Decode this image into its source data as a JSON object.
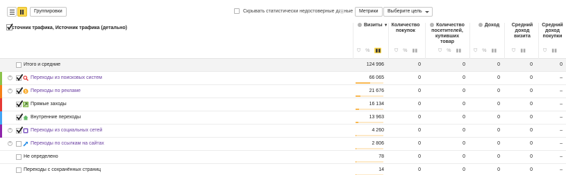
{
  "toolbar": {
    "group_button": "Группировки",
    "hide_stats_label": "Скрывать статистически недостоверные данные",
    "metrics_button": "Метрики",
    "goal_select": "Выберите цель"
  },
  "header": {
    "dimension_title": "Источник трафика, Источник трафика (детально)",
    "columns": {
      "visits": "Визиты",
      "purchases_line1": "Количество",
      "purchases_line2": "покупок",
      "buyers_line1": "Количество",
      "buyers_line2": "посетителей,",
      "buyers_line3": "купивших",
      "buyers_line4": "товар",
      "revenue": "Доход",
      "avg_visit_line1": "Средний",
      "avg_visit_line2": "доход",
      "avg_visit_line3": "визита",
      "avg_purchase_line1": "Средний",
      "avg_purchase_line2": "доход",
      "avg_purchase_line3": "покупки"
    },
    "sort_indicator": "▼",
    "icon_percent": "%",
    "icon_filter": "⛉"
  },
  "colors": {
    "accent_yellow": "#ffd84d",
    "link_purple": "#6a3ea1",
    "bar_orange": "#f8b74f"
  },
  "rows": [
    {
      "label": "Итого и средние",
      "visits": "124 996",
      "purchases": "0",
      "buyers": "0",
      "revenue": "0",
      "avg_visit": "0",
      "avg_purchase": "0",
      "visits_share": 1.0
    },
    {
      "label": "Переходы из поисковых систем",
      "visits": "66 065",
      "purchases": "0",
      "buyers": "0",
      "revenue": "0",
      "avg_visit": "0",
      "avg_purchase": "–",
      "visits_share": 0.5285,
      "stripe": "#8bc34a",
      "icon": "search-icon",
      "checked": true,
      "expandable": true
    },
    {
      "label": "Переходы по рекламе",
      "visits": "21 676",
      "purchases": "0",
      "buyers": "0",
      "revenue": "0",
      "avg_visit": "0",
      "avg_purchase": "–",
      "visits_share": 0.1734,
      "stripe": "#f57f17",
      "icon": "ad-icon",
      "checked": true,
      "expandable": true
    },
    {
      "label": "Прямые заходы",
      "visits": "16 134",
      "purchases": "0",
      "buyers": "0",
      "revenue": "0",
      "avg_visit": "0",
      "avg_purchase": "–",
      "visits_share": 0.1291,
      "stripe": "#e53935",
      "icon": "direct-icon",
      "checked": true,
      "expandable": false
    },
    {
      "label": "Внутренние переходы",
      "visits": "13 963",
      "purchases": "0",
      "buyers": "0",
      "revenue": "0",
      "avg_visit": "0",
      "avg_purchase": "–",
      "visits_share": 0.1117,
      "stripe": "#42a5f5",
      "icon": "internal-icon",
      "checked": true,
      "expandable": false
    },
    {
      "label": "Переходы из социальных сетей",
      "visits": "4 260",
      "purchases": "0",
      "buyers": "0",
      "revenue": "0",
      "avg_visit": "0",
      "avg_purchase": "–",
      "visits_share": 0.0341,
      "stripe": "#8e24aa",
      "icon": "social-icon",
      "checked": true,
      "expandable": true
    },
    {
      "label": "Переходы по ссылкам на сайтах",
      "visits": "2 806",
      "purchases": "0",
      "buyers": "0",
      "revenue": "0",
      "avg_visit": "0",
      "avg_purchase": "–",
      "visits_share": 0.0224,
      "icon": "link-icon",
      "checked": false,
      "expandable": true
    },
    {
      "label": "Не определено",
      "visits": "78",
      "purchases": "0",
      "buyers": "0",
      "revenue": "0",
      "avg_visit": "0",
      "avg_purchase": "–",
      "visits_share": 0.0006,
      "checked": false,
      "expandable": false
    },
    {
      "label": "Переходы с сохранённых страниц",
      "visits": "14",
      "purchases": "0",
      "buyers": "0",
      "revenue": "0",
      "avg_visit": "0",
      "avg_purchase": "–",
      "visits_share": 0.0001,
      "checked": false,
      "expandable": false
    }
  ]
}
